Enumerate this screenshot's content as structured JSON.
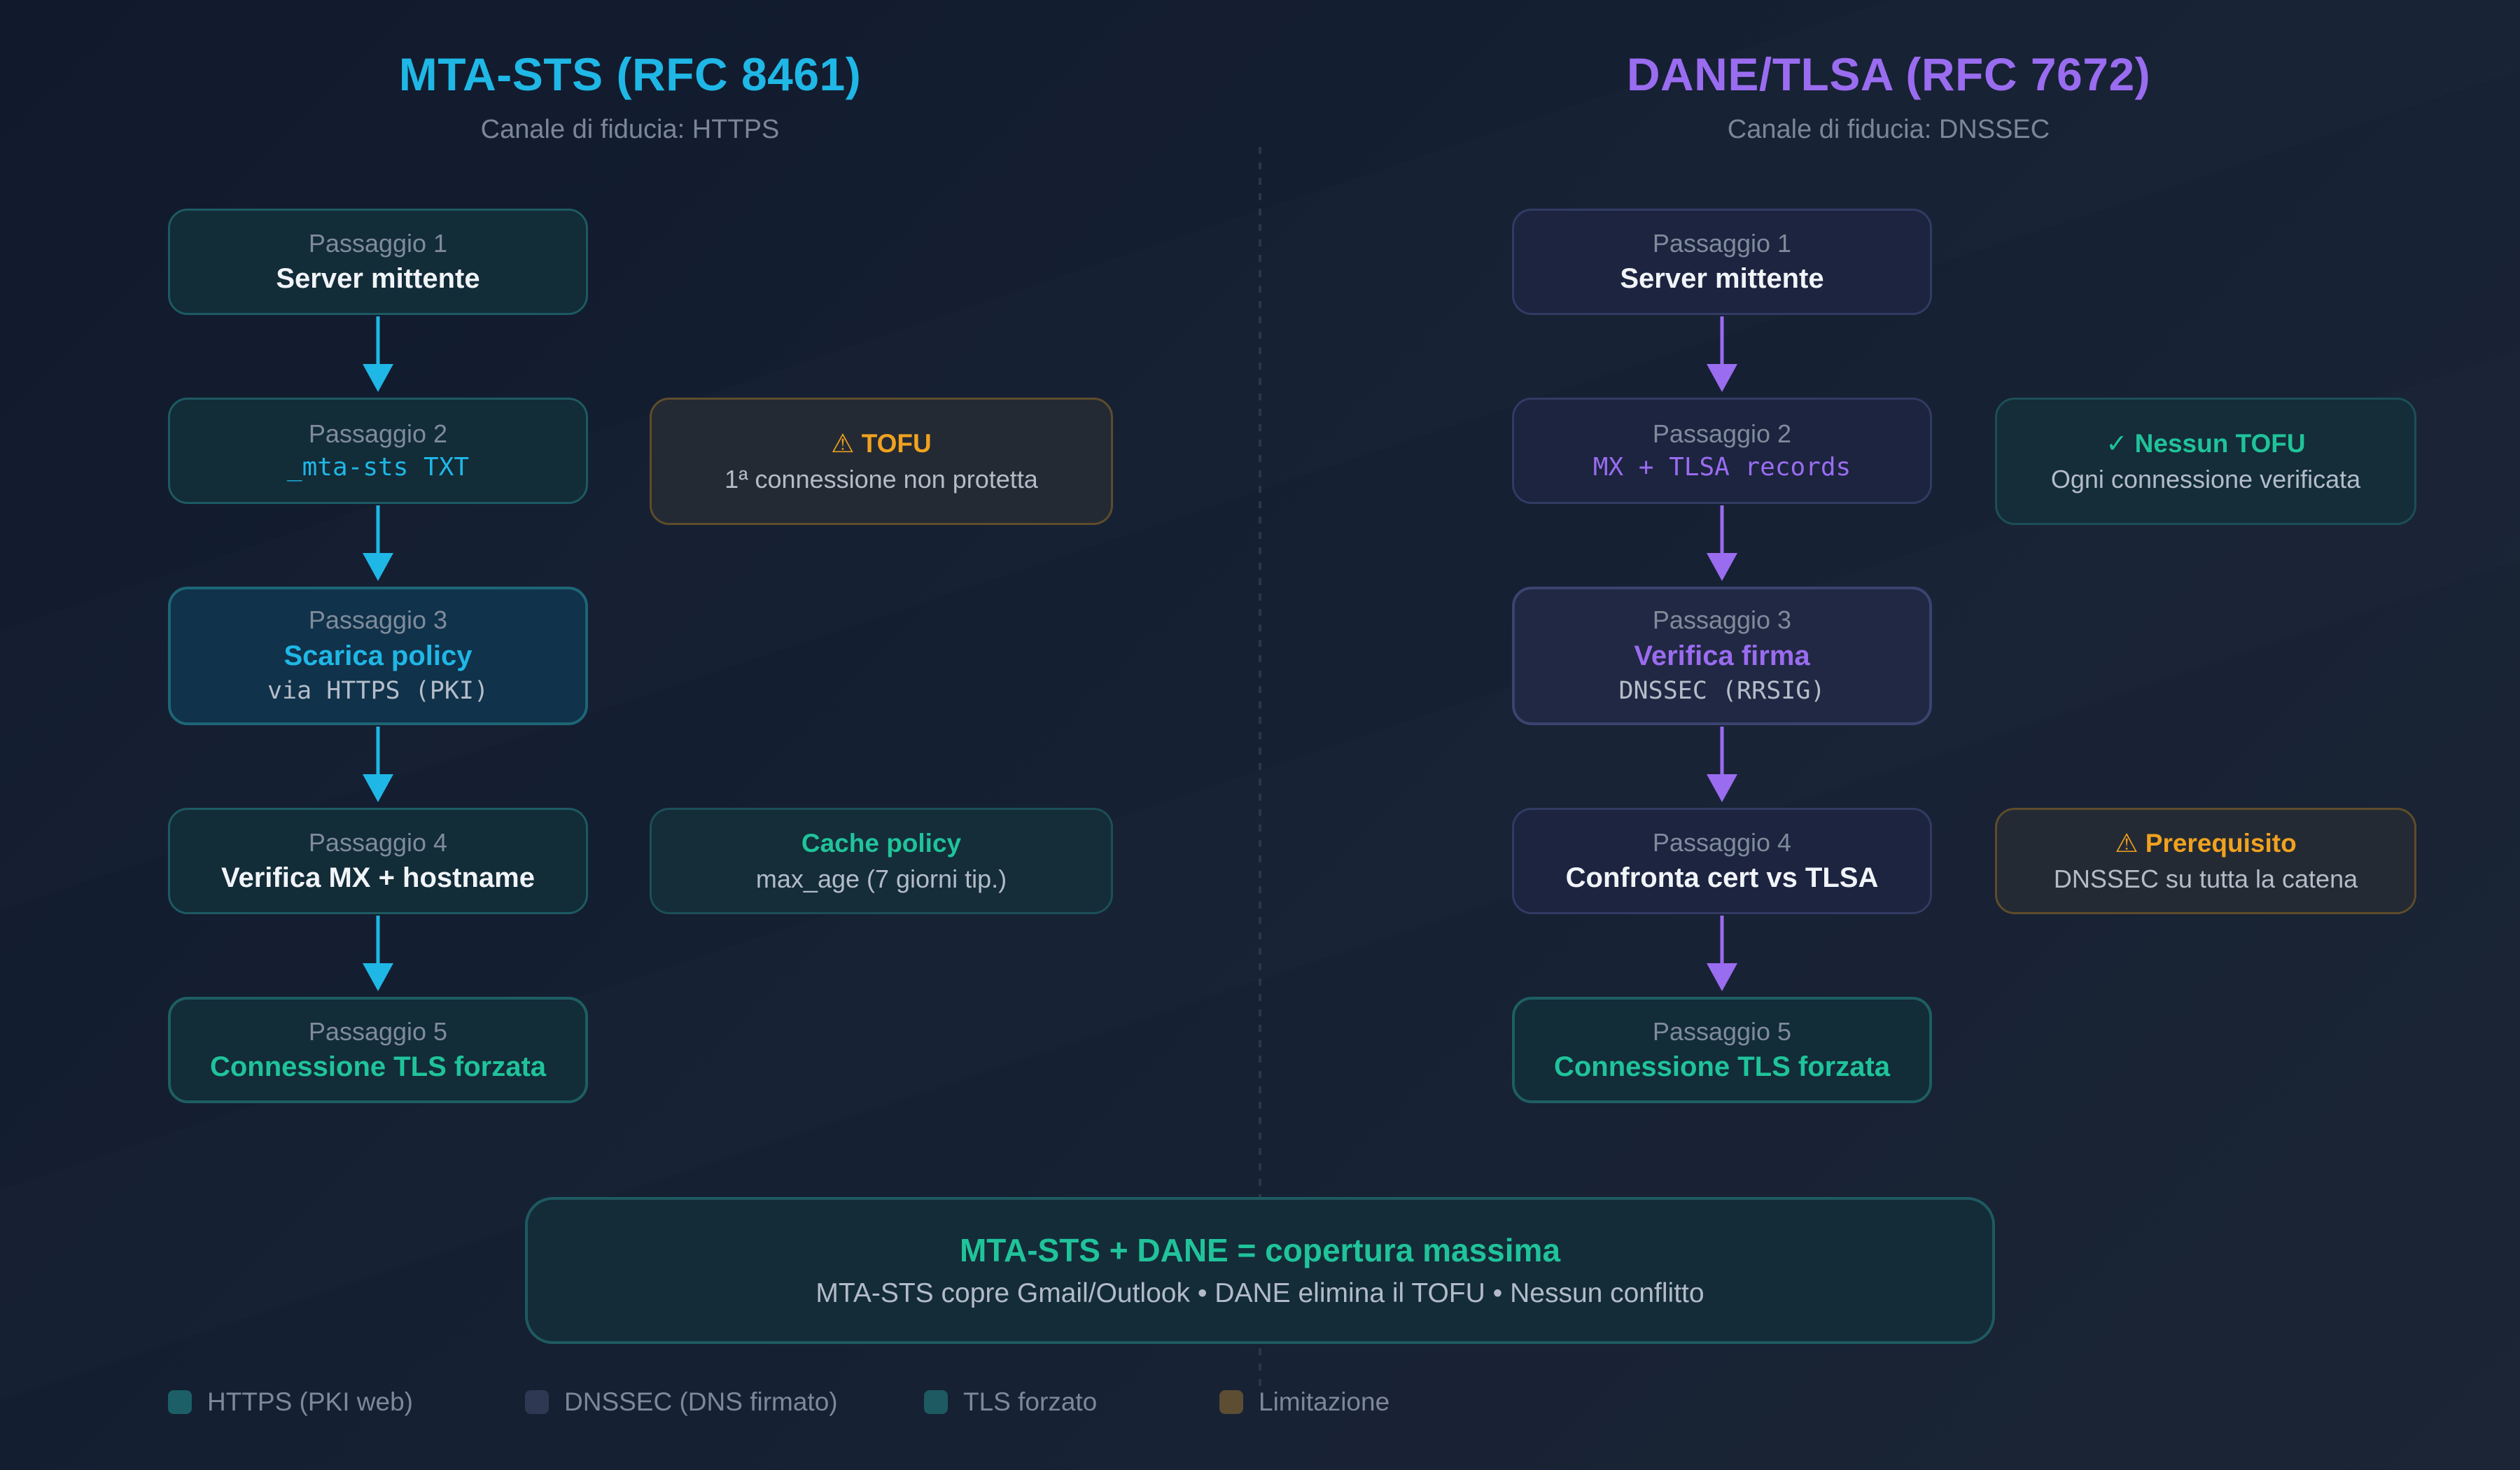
{
  "colors": {
    "mta_accent": "#1fb7e6",
    "dane_accent": "#9a6cf0",
    "tls_green": "#20c39a",
    "warning": "#f0a21f"
  },
  "mta": {
    "title": "MTA-STS (RFC 8461)",
    "subtitle": "Canale di fiducia: HTTPS",
    "steps": [
      {
        "label": "Passaggio 1",
        "title": "Server mittente"
      },
      {
        "label": "Passaggio 2",
        "title": "_mta-sts TXT"
      },
      {
        "label": "Passaggio 3",
        "title": "Scarica policy",
        "sub": "via HTTPS (PKI)"
      },
      {
        "label": "Passaggio 4",
        "title": "Verifica MX + hostname"
      },
      {
        "label": "Passaggio 5",
        "title": "Connessione TLS forzata"
      }
    ],
    "notes": [
      {
        "icon": "warning-icon",
        "title": "⚠ TOFU",
        "text": "1ª connessione non protetta"
      },
      {
        "title": "Cache policy",
        "text": "max_age (7 giorni tip.)"
      }
    ]
  },
  "dane": {
    "title": "DANE/TLSA (RFC 7672)",
    "subtitle": "Canale di fiducia: DNSSEC",
    "steps": [
      {
        "label": "Passaggio 1",
        "title": "Server mittente"
      },
      {
        "label": "Passaggio 2",
        "title": "MX + TLSA records"
      },
      {
        "label": "Passaggio 3",
        "title": "Verifica firma",
        "sub": "DNSSEC (RRSIG)"
      },
      {
        "label": "Passaggio 4",
        "title": "Confronta cert vs TLSA"
      },
      {
        "label": "Passaggio 5",
        "title": "Connessione TLS forzata"
      }
    ],
    "notes": [
      {
        "icon": "check-icon",
        "title": "✓ Nessun TOFU",
        "text": "Ogni connessione verificata"
      },
      {
        "icon": "warning-icon",
        "title": "⚠ Prerequisito",
        "text": "DNSSEC su tutta la catena"
      }
    ]
  },
  "summary": {
    "title": "MTA-STS + DANE = copertura massima",
    "text": "MTA-STS copre Gmail/Outlook • DANE elimina il TOFU • Nessun conflitto"
  },
  "legend": [
    {
      "label": "HTTPS (PKI web)",
      "color": "#1c5f66"
    },
    {
      "label": "DNSSEC (DNS firmato)",
      "color": "#2f3852"
    },
    {
      "label": "TLS forzato",
      "color": "#1d5a62"
    },
    {
      "label": "Limitazione",
      "color": "#5c4d33"
    }
  ]
}
